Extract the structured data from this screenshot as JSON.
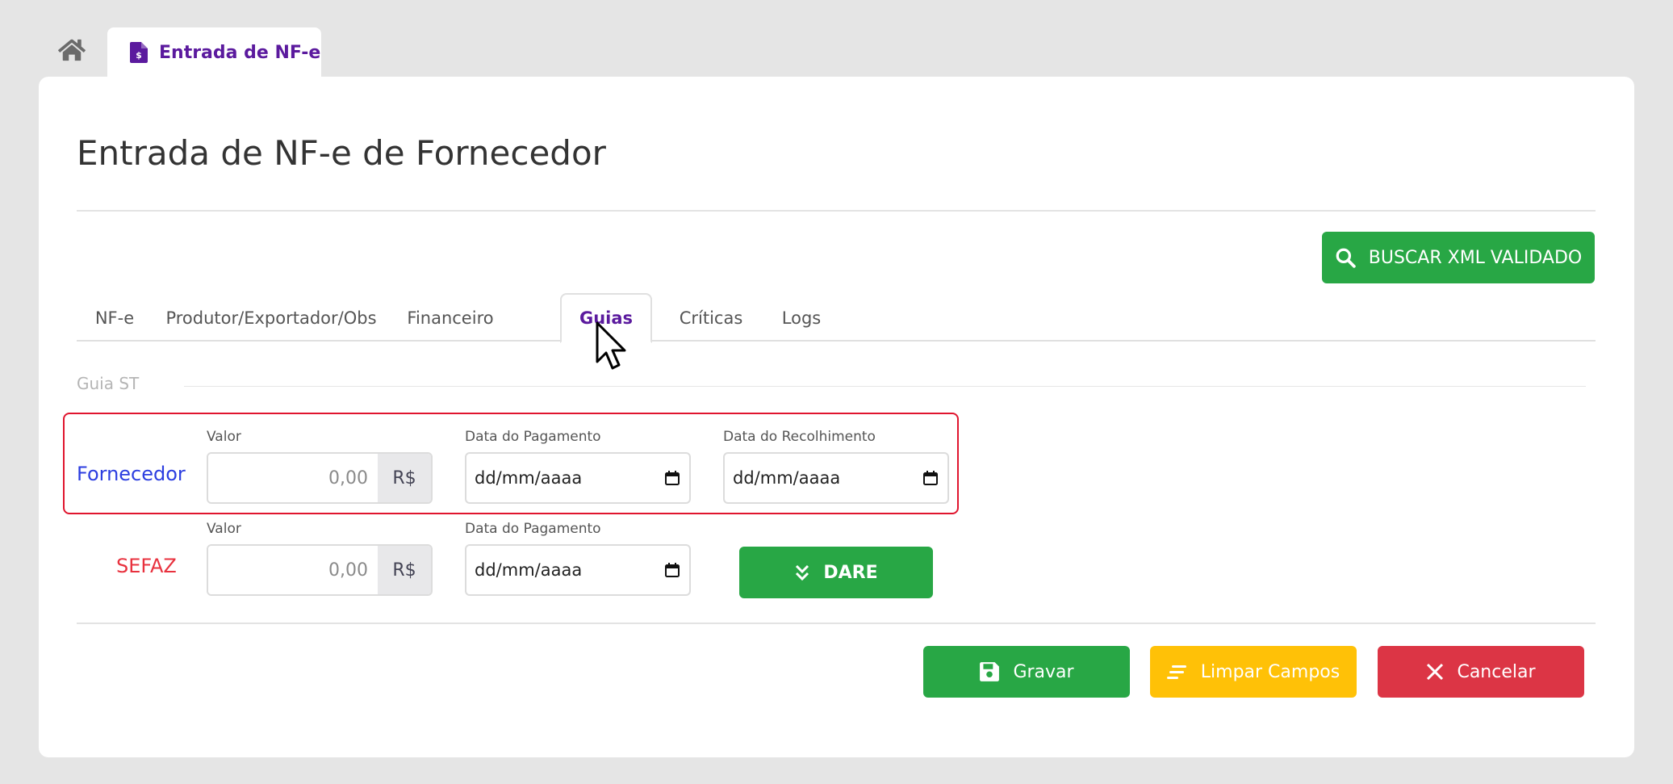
{
  "top_tabs": {
    "home_icon": "home-icon",
    "active_icon": "invoice-document-icon",
    "active_label": "Entrada de NF-e"
  },
  "page": {
    "title": "Entrada de NF-e de Fornecedor"
  },
  "toolbar": {
    "buscar_label": "BUSCAR XML VALIDADO",
    "buscar_icon": "search-icon"
  },
  "tabs": [
    {
      "label": "NF-e",
      "active": false
    },
    {
      "label": "Produtor/Exportador/Obs",
      "active": false
    },
    {
      "label": "Financeiro",
      "active": false
    },
    {
      "label": "Guias",
      "active": true
    },
    {
      "label": "Críticas",
      "active": false
    },
    {
      "label": "Logs",
      "active": false
    }
  ],
  "guia_st": {
    "legend": "Guia ST",
    "fornecedor": {
      "label": "Fornecedor",
      "valor_label": "Valor",
      "valor_placeholder": "0,00",
      "currency": "R$",
      "data_pagamento_label": "Data do Pagamento",
      "data_pagamento_value": "dd/mm/aaaa",
      "data_recolhimento_label": "Data do Recolhimento",
      "data_recolhimento_value": "dd/mm/aaaa"
    },
    "sefaz": {
      "label": "SEFAZ",
      "valor_label": "Valor",
      "valor_placeholder": "0,00",
      "currency": "R$",
      "data_pagamento_label": "Data do Pagamento",
      "data_pagamento_value": "dd/mm/aaaa",
      "dare_label": "DARE"
    }
  },
  "actions": {
    "gravar": "Gravar",
    "limpar": "Limpar Campos",
    "cancelar": "Cancelar"
  },
  "colors": {
    "primary_purple": "#5b1a9e",
    "success": "#28a745",
    "warning": "#ffc107",
    "danger": "#dc3545",
    "fornecedor_blue": "#2c3ee0",
    "sefaz_red": "#e8313e"
  }
}
